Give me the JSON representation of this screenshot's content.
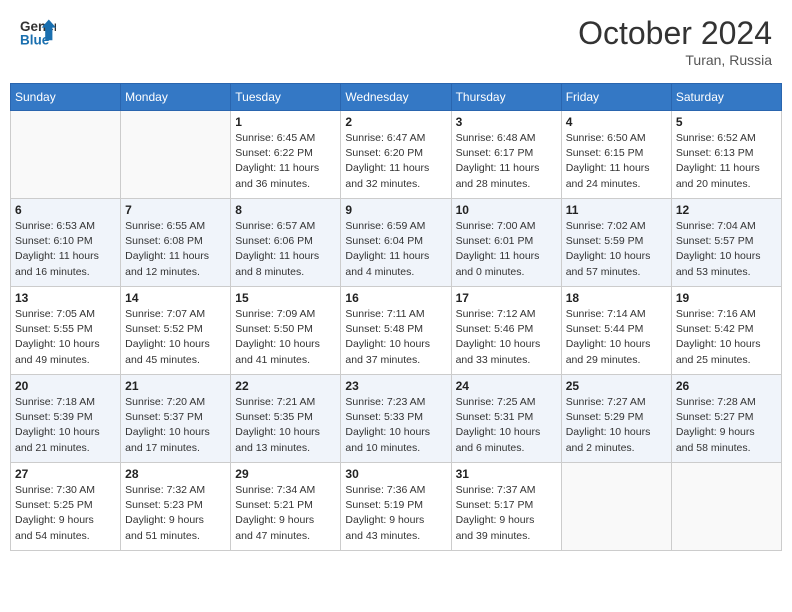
{
  "header": {
    "logo_line1": "General",
    "logo_line2": "Blue",
    "month": "October 2024",
    "location": "Turan, Russia"
  },
  "weekdays": [
    "Sunday",
    "Monday",
    "Tuesday",
    "Wednesday",
    "Thursday",
    "Friday",
    "Saturday"
  ],
  "weeks": [
    [
      {
        "day": "",
        "info": ""
      },
      {
        "day": "",
        "info": ""
      },
      {
        "day": "1",
        "info": "Sunrise: 6:45 AM\nSunset: 6:22 PM\nDaylight: 11 hours\nand 36 minutes."
      },
      {
        "day": "2",
        "info": "Sunrise: 6:47 AM\nSunset: 6:20 PM\nDaylight: 11 hours\nand 32 minutes."
      },
      {
        "day": "3",
        "info": "Sunrise: 6:48 AM\nSunset: 6:17 PM\nDaylight: 11 hours\nand 28 minutes."
      },
      {
        "day": "4",
        "info": "Sunrise: 6:50 AM\nSunset: 6:15 PM\nDaylight: 11 hours\nand 24 minutes."
      },
      {
        "day": "5",
        "info": "Sunrise: 6:52 AM\nSunset: 6:13 PM\nDaylight: 11 hours\nand 20 minutes."
      }
    ],
    [
      {
        "day": "6",
        "info": "Sunrise: 6:53 AM\nSunset: 6:10 PM\nDaylight: 11 hours\nand 16 minutes."
      },
      {
        "day": "7",
        "info": "Sunrise: 6:55 AM\nSunset: 6:08 PM\nDaylight: 11 hours\nand 12 minutes."
      },
      {
        "day": "8",
        "info": "Sunrise: 6:57 AM\nSunset: 6:06 PM\nDaylight: 11 hours\nand 8 minutes."
      },
      {
        "day": "9",
        "info": "Sunrise: 6:59 AM\nSunset: 6:04 PM\nDaylight: 11 hours\nand 4 minutes."
      },
      {
        "day": "10",
        "info": "Sunrise: 7:00 AM\nSunset: 6:01 PM\nDaylight: 11 hours\nand 0 minutes."
      },
      {
        "day": "11",
        "info": "Sunrise: 7:02 AM\nSunset: 5:59 PM\nDaylight: 10 hours\nand 57 minutes."
      },
      {
        "day": "12",
        "info": "Sunrise: 7:04 AM\nSunset: 5:57 PM\nDaylight: 10 hours\nand 53 minutes."
      }
    ],
    [
      {
        "day": "13",
        "info": "Sunrise: 7:05 AM\nSunset: 5:55 PM\nDaylight: 10 hours\nand 49 minutes."
      },
      {
        "day": "14",
        "info": "Sunrise: 7:07 AM\nSunset: 5:52 PM\nDaylight: 10 hours\nand 45 minutes."
      },
      {
        "day": "15",
        "info": "Sunrise: 7:09 AM\nSunset: 5:50 PM\nDaylight: 10 hours\nand 41 minutes."
      },
      {
        "day": "16",
        "info": "Sunrise: 7:11 AM\nSunset: 5:48 PM\nDaylight: 10 hours\nand 37 minutes."
      },
      {
        "day": "17",
        "info": "Sunrise: 7:12 AM\nSunset: 5:46 PM\nDaylight: 10 hours\nand 33 minutes."
      },
      {
        "day": "18",
        "info": "Sunrise: 7:14 AM\nSunset: 5:44 PM\nDaylight: 10 hours\nand 29 minutes."
      },
      {
        "day": "19",
        "info": "Sunrise: 7:16 AM\nSunset: 5:42 PM\nDaylight: 10 hours\nand 25 minutes."
      }
    ],
    [
      {
        "day": "20",
        "info": "Sunrise: 7:18 AM\nSunset: 5:39 PM\nDaylight: 10 hours\nand 21 minutes."
      },
      {
        "day": "21",
        "info": "Sunrise: 7:20 AM\nSunset: 5:37 PM\nDaylight: 10 hours\nand 17 minutes."
      },
      {
        "day": "22",
        "info": "Sunrise: 7:21 AM\nSunset: 5:35 PM\nDaylight: 10 hours\nand 13 minutes."
      },
      {
        "day": "23",
        "info": "Sunrise: 7:23 AM\nSunset: 5:33 PM\nDaylight: 10 hours\nand 10 minutes."
      },
      {
        "day": "24",
        "info": "Sunrise: 7:25 AM\nSunset: 5:31 PM\nDaylight: 10 hours\nand 6 minutes."
      },
      {
        "day": "25",
        "info": "Sunrise: 7:27 AM\nSunset: 5:29 PM\nDaylight: 10 hours\nand 2 minutes."
      },
      {
        "day": "26",
        "info": "Sunrise: 7:28 AM\nSunset: 5:27 PM\nDaylight: 9 hours\nand 58 minutes."
      }
    ],
    [
      {
        "day": "27",
        "info": "Sunrise: 7:30 AM\nSunset: 5:25 PM\nDaylight: 9 hours\nand 54 minutes."
      },
      {
        "day": "28",
        "info": "Sunrise: 7:32 AM\nSunset: 5:23 PM\nDaylight: 9 hours\nand 51 minutes."
      },
      {
        "day": "29",
        "info": "Sunrise: 7:34 AM\nSunset: 5:21 PM\nDaylight: 9 hours\nand 47 minutes."
      },
      {
        "day": "30",
        "info": "Sunrise: 7:36 AM\nSunset: 5:19 PM\nDaylight: 9 hours\nand 43 minutes."
      },
      {
        "day": "31",
        "info": "Sunrise: 7:37 AM\nSunset: 5:17 PM\nDaylight: 9 hours\nand 39 minutes."
      },
      {
        "day": "",
        "info": ""
      },
      {
        "day": "",
        "info": ""
      }
    ]
  ]
}
